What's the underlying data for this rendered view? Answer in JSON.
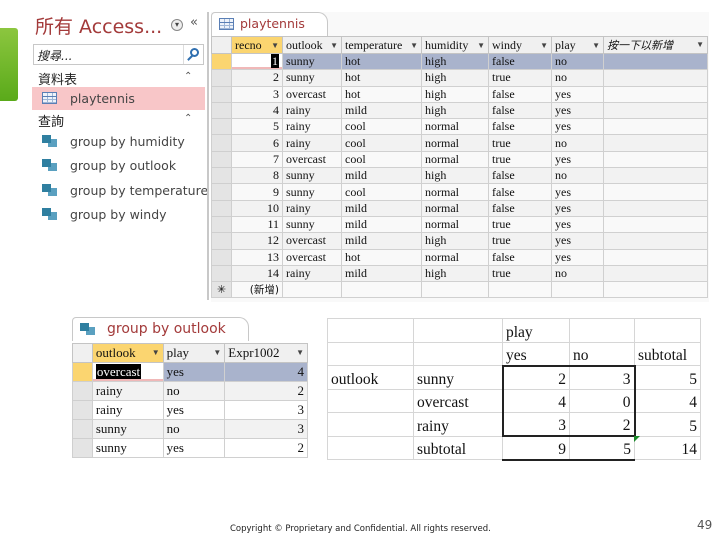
{
  "nav": {
    "title": "所有 Access...",
    "dropdown_glyph": "▾",
    "collapse_glyph": "«",
    "search_placeholder": "搜尋...",
    "groups": [
      {
        "label": "資料表",
        "chevron": "⌃",
        "items": [
          {
            "label": "playtennis",
            "icon": "table-icon",
            "selected": true
          }
        ]
      },
      {
        "label": "查詢",
        "chevron": "⌃",
        "items": [
          {
            "label": "group by humidity",
            "icon": "query-icon"
          },
          {
            "label": "group by outlook",
            "icon": "query-icon"
          },
          {
            "label": "group by temperature",
            "icon": "query-icon"
          },
          {
            "label": "group by windy",
            "icon": "query-icon"
          }
        ]
      }
    ]
  },
  "datasheet": {
    "tab_label": "playtennis",
    "columns": [
      "recno",
      "outlook",
      "temperature",
      "humidity",
      "windy",
      "play",
      "按一下以新增"
    ],
    "rows": [
      [
        "1",
        "sunny",
        "hot",
        "high",
        "false",
        "no"
      ],
      [
        "2",
        "sunny",
        "hot",
        "high",
        "true",
        "no"
      ],
      [
        "3",
        "overcast",
        "hot",
        "high",
        "false",
        "yes"
      ],
      [
        "4",
        "rainy",
        "mild",
        "high",
        "false",
        "yes"
      ],
      [
        "5",
        "rainy",
        "cool",
        "normal",
        "false",
        "yes"
      ],
      [
        "6",
        "rainy",
        "cool",
        "normal",
        "true",
        "no"
      ],
      [
        "7",
        "overcast",
        "cool",
        "normal",
        "true",
        "yes"
      ],
      [
        "8",
        "sunny",
        "mild",
        "high",
        "false",
        "no"
      ],
      [
        "9",
        "sunny",
        "cool",
        "normal",
        "false",
        "yes"
      ],
      [
        "10",
        "rainy",
        "mild",
        "normal",
        "false",
        "yes"
      ],
      [
        "11",
        "sunny",
        "mild",
        "normal",
        "true",
        "yes"
      ],
      [
        "12",
        "overcast",
        "mild",
        "high",
        "true",
        "yes"
      ],
      [
        "13",
        "overcast",
        "hot",
        "normal",
        "false",
        "yes"
      ],
      [
        "14",
        "rainy",
        "mild",
        "high",
        "true",
        "no"
      ]
    ],
    "new_row_marker": "✳",
    "new_row_label": "(新增)"
  },
  "query_result": {
    "tab_label": "group by outlook",
    "columns": [
      "outlook",
      "play",
      "Expr1002"
    ],
    "rows": [
      [
        "overcast",
        "yes",
        "4"
      ],
      [
        "rainy",
        "no",
        "2"
      ],
      [
        "rainy",
        "yes",
        "3"
      ],
      [
        "sunny",
        "no",
        "3"
      ],
      [
        "sunny",
        "yes",
        "2"
      ]
    ]
  },
  "pivot": {
    "header_row1": [
      "",
      "",
      "play",
      "",
      ""
    ],
    "header_row2": [
      "",
      "",
      "yes",
      "no",
      "subtotal"
    ],
    "rows": [
      [
        "outlook",
        "sunny",
        "2",
        "3",
        "5"
      ],
      [
        "",
        "overcast",
        "4",
        "0",
        "4"
      ],
      [
        "",
        "rainy",
        "3",
        "2",
        "5"
      ],
      [
        "",
        "subtotal",
        "9",
        "5",
        "14"
      ]
    ]
  },
  "footer": {
    "copyright": "Copyright © Proprietary and Confidential. All rights reserved.",
    "page_number": "49"
  },
  "colors": {
    "accent": "#a33a3a",
    "selection_header": "#fbd570",
    "current_row": "#a9b3cc",
    "nav_selected": "#f8c6c8"
  }
}
